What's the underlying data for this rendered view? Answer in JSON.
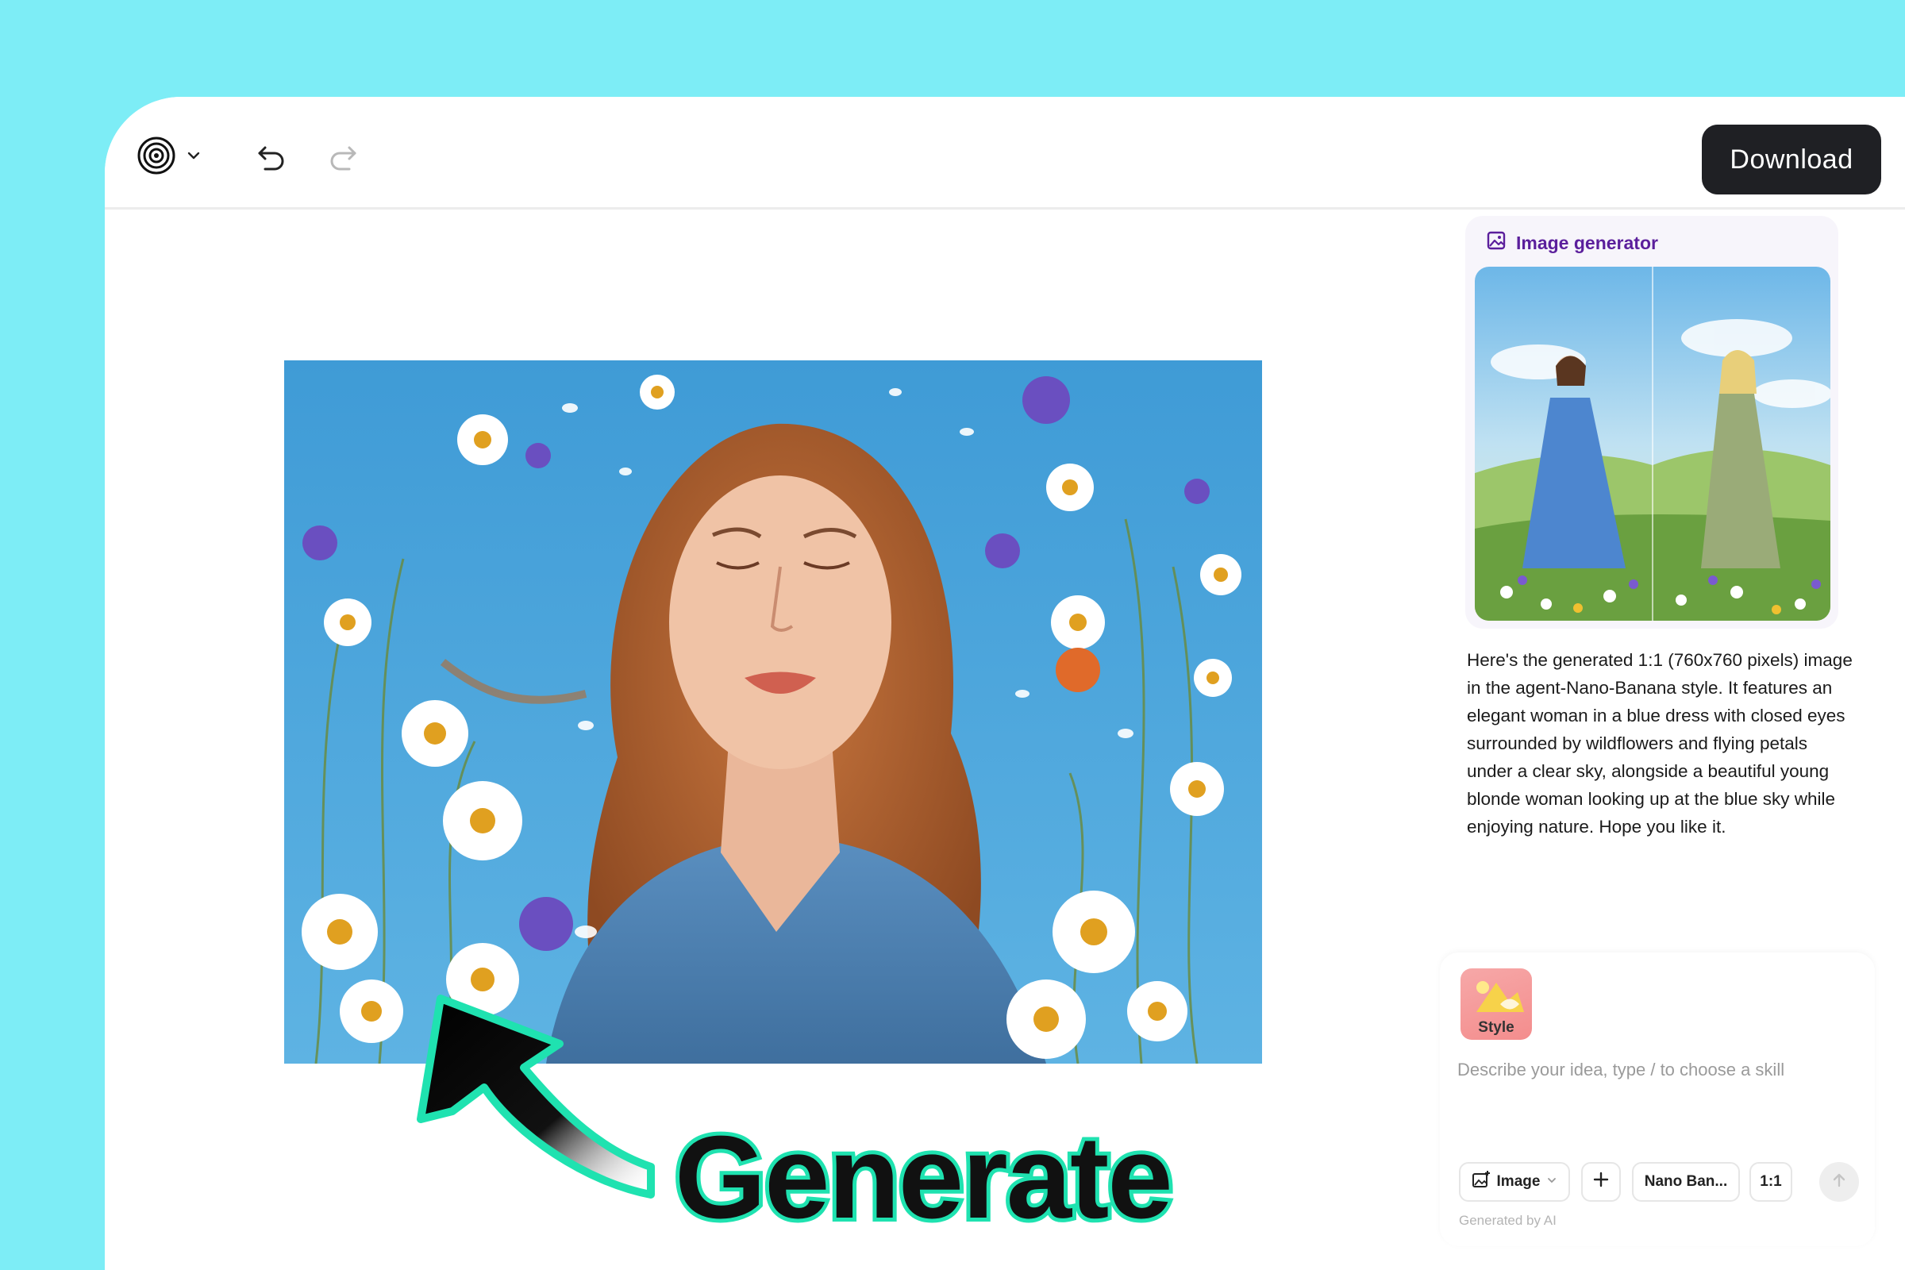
{
  "toolbar": {
    "logo_icon": "spiral-logo-icon",
    "download_label": "Download"
  },
  "generator_card": {
    "title": "Image generator",
    "title_color": "#5b1f9c"
  },
  "response": {
    "text": "Here's the generated 1:1 (760x760 pixels) image in the agent-Nano-Banana style. It features an elegant woman in a blue dress with closed eyes surrounded by wildflowers and flying petals under a clear sky, alongside a beautiful young blonde woman looking up at the blue sky while enjoying nature. Hope you like it."
  },
  "composer": {
    "style_label": "Style",
    "placeholder": "Describe your idea, type / to choose a skill",
    "image_label": "Image",
    "model_label": "Nano Ban...",
    "ratio_label": "1:1",
    "footnote": "Generated by AI"
  },
  "annotation": {
    "text": "Generate",
    "outline_color": "#1fe2b0"
  },
  "colors": {
    "background": "#7DEDF6",
    "download_bg": "#1f2024"
  }
}
